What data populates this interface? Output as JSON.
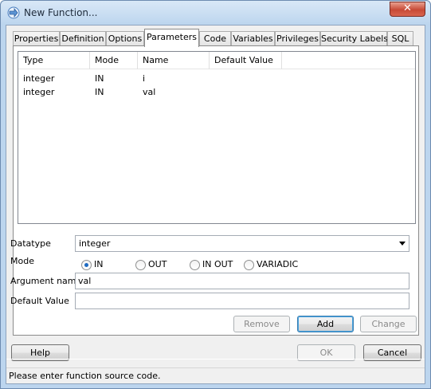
{
  "window": {
    "title": "New Function...",
    "close_label": "✕"
  },
  "tabs": [
    {
      "label": "Properties"
    },
    {
      "label": "Definition"
    },
    {
      "label": "Options"
    },
    {
      "label": "Parameters",
      "active": true
    },
    {
      "label": "Code"
    },
    {
      "label": "Variables"
    },
    {
      "label": "Privileges"
    },
    {
      "label": "Security Labels"
    },
    {
      "label": "SQL"
    }
  ],
  "grid": {
    "columns": [
      "Type",
      "Mode",
      "Name",
      "Default Value"
    ],
    "rows": [
      [
        "integer",
        "IN",
        "i",
        ""
      ],
      [
        "integer",
        "IN",
        "val",
        ""
      ]
    ]
  },
  "form": {
    "datatype_label": "Datatype",
    "datatype_value": "integer",
    "mode_label": "Mode",
    "mode_options": [
      "IN",
      "OUT",
      "IN OUT",
      "VARIADIC"
    ],
    "mode_selected": "IN",
    "argname_label": "Argument name",
    "argname_value": "val",
    "default_label": "Default Value",
    "default_value": ""
  },
  "param_buttons": {
    "remove": "Remove",
    "add": "Add",
    "change": "Change"
  },
  "dialog_buttons": {
    "help": "Help",
    "ok": "OK",
    "cancel": "Cancel"
  },
  "status": "Please enter function source code.",
  "colors": {
    "accent": "#1d6ac2",
    "title_bg": "#bcd5ee",
    "close_red": "#c74a36"
  }
}
